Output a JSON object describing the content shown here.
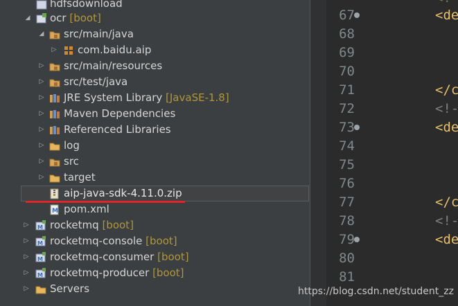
{
  "tree": {
    "hdfsdownload": "hdfsdownload",
    "ocr": {
      "name": "ocr",
      "deco": "[boot]"
    },
    "src_main_java": "src/main/java",
    "package": "com.baidu.aip",
    "src_main_resources": "src/main/resources",
    "src_test_java": "src/test/java",
    "jre": {
      "name": "JRE System Library",
      "deco": "[JavaSE-1.8]"
    },
    "maven": "Maven Dependencies",
    "referenced": "Referenced Libraries",
    "log": "log",
    "src": "src",
    "target": "target",
    "zip": "aip-java-sdk-4.11.0.zip",
    "pom": "pom.xml",
    "rocketmq": {
      "name": "rocketmq",
      "deco": "[boot]"
    },
    "rocketmq_console": {
      "name": "rocketmq-console",
      "deco": "[boot]"
    },
    "rocketmq_consumer": {
      "name": "rocketmq-consumer",
      "deco": "[boot]"
    },
    "rocketmq_producer": {
      "name": "rocketmq-producer",
      "deco": "[boot]"
    },
    "servers": "Servers"
  },
  "editor": {
    "lines": [
      "67",
      "68",
      "69",
      "70",
      "71",
      "72",
      "73",
      "74",
      "75",
      "76",
      "77",
      "78",
      "79",
      "80",
      "81"
    ],
    "code": {
      "l66": "<!",
      "l67": "<de",
      "l71": "</c",
      "l72": "<!-",
      "l73": "<de",
      "l77": "</c",
      "l78": "<!-",
      "l79": "<de"
    }
  },
  "colors": {
    "tree_bg": "#3c3f41",
    "editor_bg": "#2b2b2b",
    "deco": "#b0963c",
    "underline": "#e0242a",
    "tag": "#e8bf6a"
  },
  "watermark": "https://blog.csdn.net/student_zz"
}
